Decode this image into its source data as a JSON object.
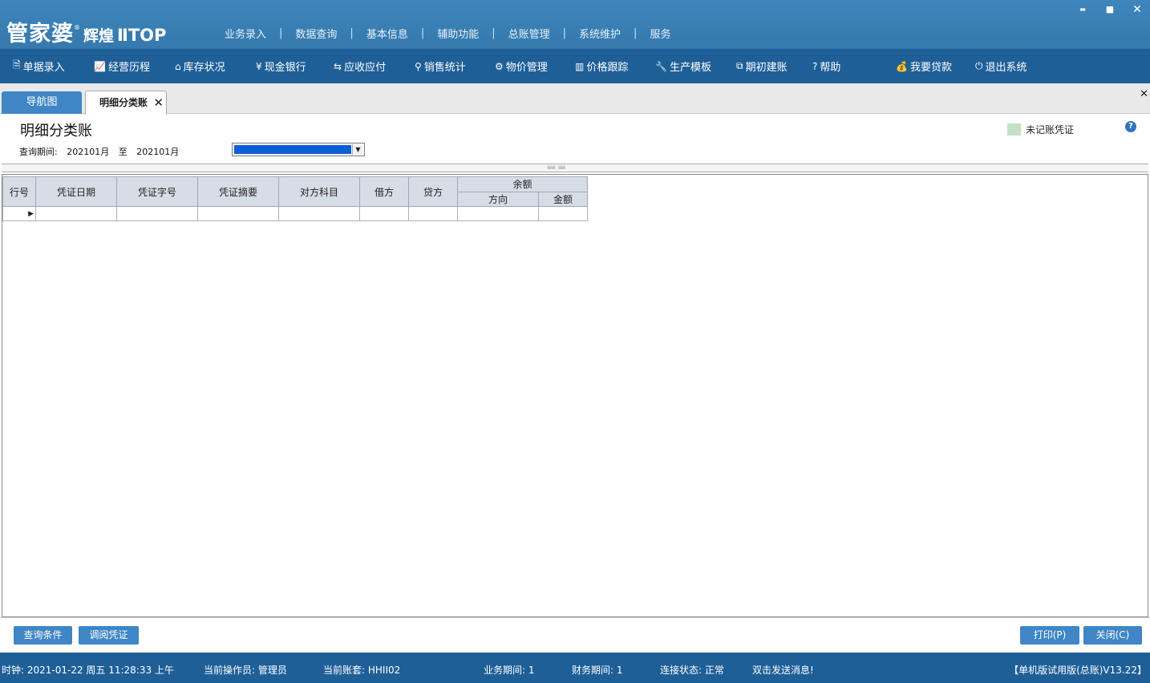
{
  "app": {
    "logo_main": "管家婆",
    "logo_sub": "辉煌",
    "logo_top": "ⅡTOP",
    "logo_reg": "®"
  },
  "top_menu": [
    "业务录入",
    "数据查询",
    "基本信息",
    "辅助功能",
    "总账管理",
    "系统维护",
    "服务"
  ],
  "window_controls": {
    "minimize": "▬",
    "maximize": "■",
    "close": "✕"
  },
  "toolbar": [
    {
      "icon": "document-icon",
      "glyph": "🗎",
      "label": "单据录入"
    },
    {
      "icon": "trend-chart-icon",
      "glyph": "📈",
      "label": "经营历程"
    },
    {
      "icon": "home-icon",
      "glyph": "⌂",
      "label": "库存状况"
    },
    {
      "icon": "yen-icon",
      "glyph": "¥",
      "label": "现金银行"
    },
    {
      "icon": "exchange-arrows-icon",
      "glyph": "⇆",
      "label": "应收应付"
    },
    {
      "icon": "search-icon",
      "glyph": "⚲",
      "label": "销售统计"
    },
    {
      "icon": "gear-icon",
      "glyph": "⚙",
      "label": "物价管理"
    },
    {
      "icon": "bar-chart-icon",
      "glyph": "▥",
      "label": "价格跟踪"
    },
    {
      "icon": "wrench-icon",
      "glyph": "🔧",
      "label": "生产模板"
    },
    {
      "icon": "external-link-icon",
      "glyph": "⧉",
      "label": "期初建账"
    },
    {
      "icon": "question-icon",
      "glyph": "?",
      "label": "帮助"
    },
    {
      "icon": "money-bag-icon",
      "glyph": "💰",
      "label": "我要贷款"
    },
    {
      "icon": "power-icon",
      "glyph": "⏻",
      "label": "退出系统"
    }
  ],
  "tabs": {
    "nav": "导航图",
    "current": "明细分类账",
    "close": "✕",
    "panel_close": "✕"
  },
  "header": {
    "title": "明细分类账",
    "period_label": "查询期间:",
    "period_from": "202101月",
    "period_to_word": "至",
    "period_to": "202101月",
    "legend_label": "未记账凭证",
    "legend_color": "#c6e0c6",
    "help": "?"
  },
  "grid": {
    "columns": [
      "行号",
      "凭证日期",
      "凭证字号",
      "凭证摘要",
      "对方科目",
      "借方",
      "贷方"
    ],
    "group_header": "余额",
    "group_columns": [
      "方向",
      "金额"
    ],
    "row_indicator": "▶"
  },
  "buttons": {
    "query_conditions": "查询条件",
    "view_voucher": "调阅凭证",
    "print": "打印(P)",
    "close": "关闭(C)"
  },
  "status": {
    "clock": "时钟: 2021-01-22 周五 11:28:33 上午",
    "operator": "当前操作员: 管理员",
    "account_set": "当前账套: HHII02",
    "business_period": "业务期间: 1",
    "finance_period": "财务期间: 1",
    "connection": "连接状态: 正常",
    "message": "双击发送消息!",
    "version": "【单机版试用版(总账)V13.22】"
  },
  "colors": {
    "title_bar": "#3579ad",
    "toolbar": "#1f5f98",
    "button": "#3e86c6",
    "selection": "#0b5fd6"
  }
}
